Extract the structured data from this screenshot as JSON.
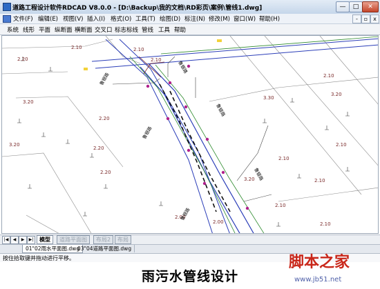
{
  "window": {
    "title": "道路工程设计软件RDCAD V8.0.0 - [D:\\Backup\\我的文档\\RD彩页\\案例\\管线1.dwg]",
    "min_label": "—",
    "max_label": "□",
    "close_label": "✕"
  },
  "menubar": {
    "items": [
      "文件(F)",
      "编辑(E)",
      "视图(V)",
      "插入(I)",
      "格式(O)",
      "工具(T)",
      "绘图(D)",
      "标注(N)",
      "修改(M)",
      "窗口(W)",
      "帮助(H)"
    ],
    "mdi_min": "-",
    "mdi_max": "▫",
    "mdi_close": "x"
  },
  "toolbar": {
    "items": [
      "系统",
      "线形",
      "平面",
      "纵断面",
      "横断面",
      "交叉口",
      "标志标线",
      "管线",
      "工具",
      "帮助"
    ]
  },
  "drawing": {
    "elevations": [
      "2.10",
      "2.20",
      "2.10",
      "2.10",
      "3.20",
      "2.20",
      "3.20",
      "3.30",
      "2.20",
      "2.10",
      "2.20",
      "2.10",
      "3.20",
      "2.10",
      "3.20",
      "2.10",
      "2.00",
      "2.10",
      "2.10",
      "2.00"
    ],
    "street_labels": [
      "鲁银路",
      "鲁银路",
      "鲁银路",
      "鲁银路",
      "鲁银路",
      "鲁银路"
    ]
  },
  "layout_tabs": [
    "模型",
    "道路平面图",
    "布局2",
    "布局"
  ],
  "doc_tabs": [
    "01\"02雨水平面图.dwg",
    "03\"04道路平面图.dwg"
  ],
  "command_line": "按住拾取键并拖动进行平移。",
  "caption": "雨污水管线设计",
  "watermark": {
    "site_name": "脚本之家",
    "url": "www.jb51.net"
  },
  "colors": {
    "road_line": "#2a3db8",
    "pipe_line": "#2e8b2e",
    "dim_line": "#4a6fd6",
    "elev_text": "#7a2a2a",
    "node": "#b0208c"
  }
}
